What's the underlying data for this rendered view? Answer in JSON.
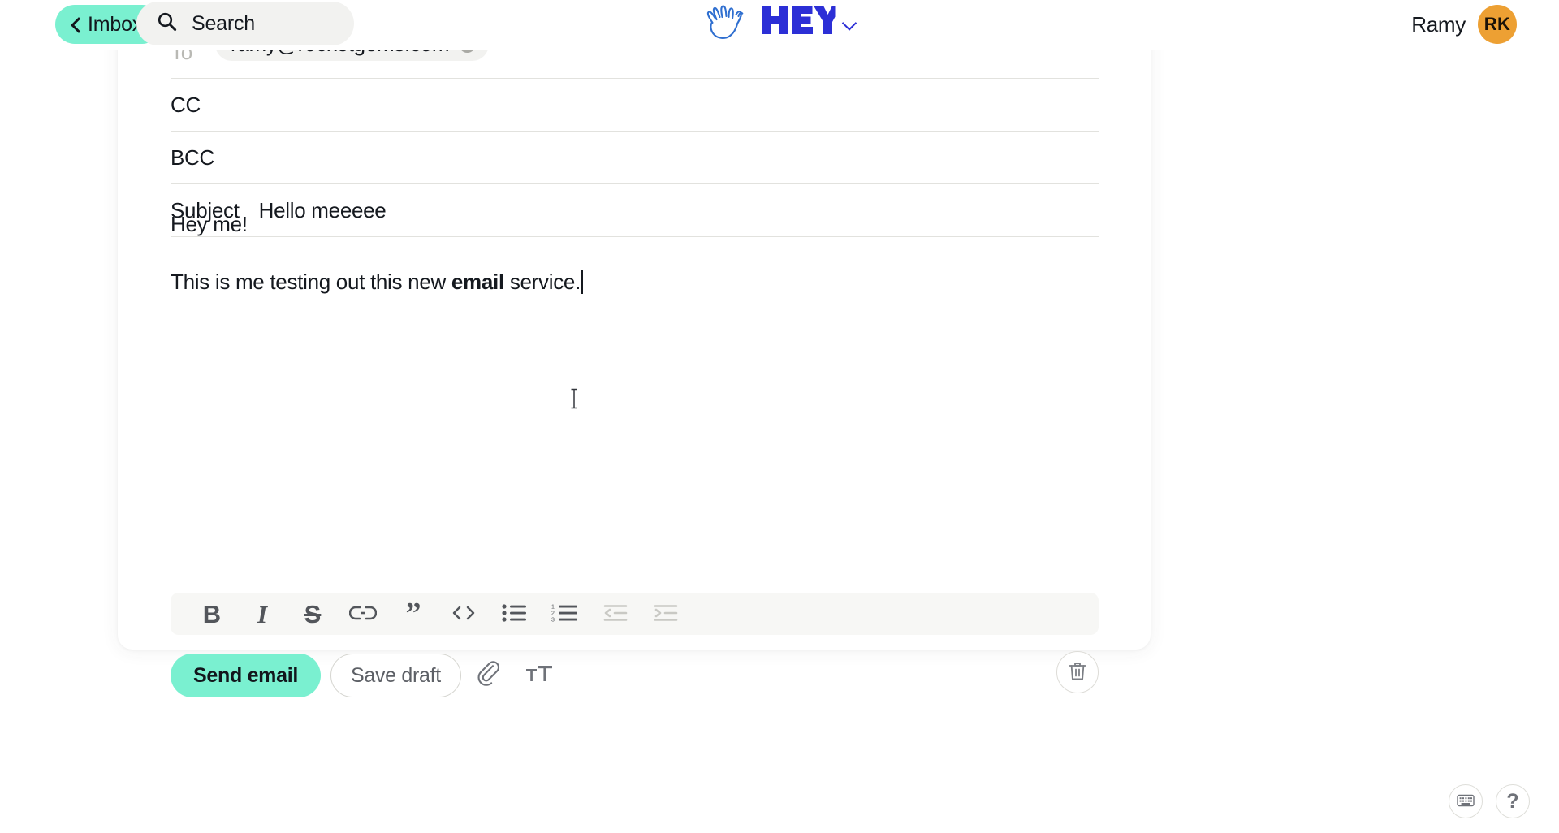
{
  "topbar": {
    "back_button": {
      "label": "Imbox",
      "icon": "chevron-left-icon"
    },
    "search": {
      "placeholder": "Search",
      "icon": "search-icon"
    },
    "logo": {
      "brand": "HEY",
      "icon": "waving-hand-icon",
      "chevron": "chevron-down-icon"
    },
    "account": {
      "name": "Ramy",
      "initials": "RK",
      "avatar_color": "#eda033"
    }
  },
  "compose": {
    "to": {
      "label": "To",
      "recipient": "ramy@rocketgems.com",
      "remove_icon": "close-circle-icon"
    },
    "cc": {
      "label": "CC",
      "value": ""
    },
    "bcc": {
      "label": "BCC",
      "value": ""
    },
    "subject": {
      "label": "Subject",
      "value": "Hello meeeee"
    },
    "body": {
      "paragraph_1": "Hey me!",
      "paragraph_2_before": "This is me testing out this new ",
      "paragraph_2_bold": "email",
      "paragraph_2_after": " service."
    }
  },
  "format_toolbar": {
    "buttons": [
      {
        "name": "bold-button",
        "glyph": "B",
        "style": "bold",
        "disabled": false
      },
      {
        "name": "italic-button",
        "glyph": "I",
        "style": "ital",
        "disabled": false
      },
      {
        "name": "strikethrough-button",
        "glyph": "S",
        "style": "strike",
        "disabled": false
      },
      {
        "name": "link-button",
        "glyph": "link-icon",
        "style": "svg",
        "disabled": false
      },
      {
        "name": "blockquote-button",
        "glyph": "”",
        "style": "quote",
        "disabled": false
      },
      {
        "name": "code-button",
        "glyph": "‹›",
        "style": "code",
        "disabled": false
      },
      {
        "name": "bullet-list-button",
        "glyph": "bullet-list-icon",
        "style": "svg",
        "disabled": false
      },
      {
        "name": "numbered-list-button",
        "glyph": "numbered-list-icon",
        "style": "svg",
        "disabled": false
      },
      {
        "name": "outdent-button",
        "glyph": "outdent-icon",
        "style": "svg",
        "disabled": true
      },
      {
        "name": "indent-button",
        "glyph": "indent-icon",
        "style": "svg",
        "disabled": true
      }
    ]
  },
  "actions": {
    "send_label": "Send email",
    "send_color": "#7af0d0",
    "draft_label": "Save draft",
    "attach_icon": "paperclip-icon",
    "text_size_icon": "text-size-icon",
    "delete_icon": "trash-icon"
  },
  "corner": {
    "keyboard_icon": "keyboard-icon",
    "help_label": "?"
  }
}
